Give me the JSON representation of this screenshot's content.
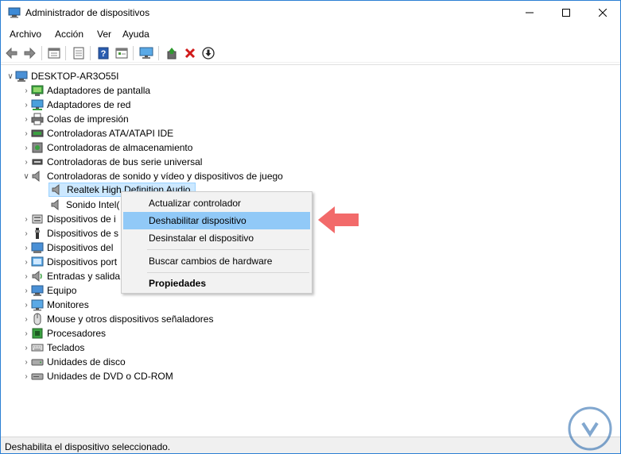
{
  "window": {
    "title": "Administrador de dispositivos"
  },
  "menu": [
    "Archivo",
    "Acción",
    "Ver",
    "Ayuda"
  ],
  "toolbar": {
    "icons": [
      "back-icon",
      "forward-icon",
      "properties-grid-icon",
      "list-icon",
      "help-icon",
      "view-icon",
      "monitor-icon",
      "update-driver-icon",
      "uninstall-icon",
      "download-icon"
    ]
  },
  "tree": {
    "root": "DESKTOP-AR3O55I",
    "items": [
      "Adaptadores de pantalla",
      "Adaptadores de red",
      "Colas de impresión",
      "Controladoras ATA/ATAPI IDE",
      "Controladoras de almacenamiento",
      "Controladoras de bus serie universal",
      "Controladoras de sonido y vídeo y dispositivos de juego",
      "Realtek High Definition Audio",
      "Sonido Intel(",
      "Dispositivos de i",
      "Dispositivos de s",
      "Dispositivos del",
      "Dispositivos port",
      "Entradas y salida",
      "Equipo",
      "Monitores",
      "Mouse y otros dispositivos señaladores",
      "Procesadores",
      "Teclados",
      "Unidades de disco",
      "Unidades de DVD o CD-ROM"
    ]
  },
  "context_menu": {
    "update": "Actualizar controlador",
    "disable": "Deshabilitar dispositivo",
    "uninstall": "Desinstalar el dispositivo",
    "scan": "Buscar cambios de hardware",
    "properties": "Propiedades"
  },
  "status": {
    "text": "Deshabilita el dispositivo seleccionado."
  },
  "colors": {
    "highlight": "#91c9f7",
    "selected": "#cce8ff",
    "arrow": "#f26a6a",
    "watermark": "#1a5fa8"
  }
}
